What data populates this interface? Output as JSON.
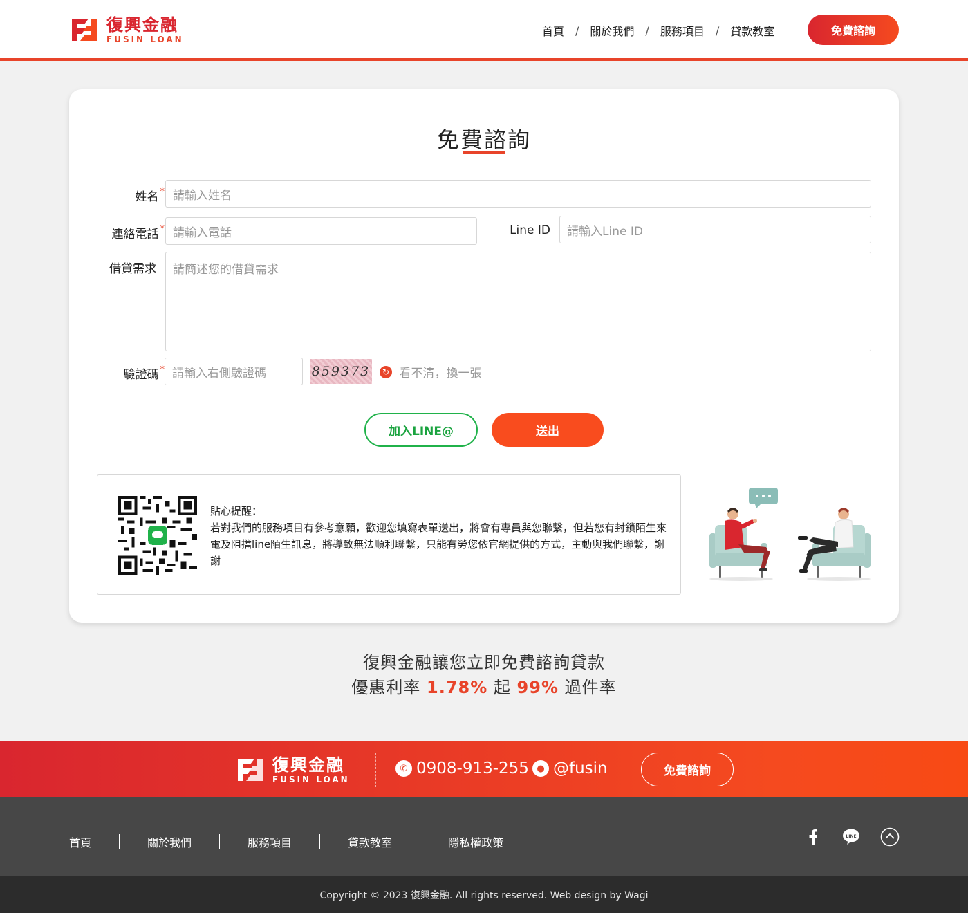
{
  "header": {
    "logo_zh": "復興金融",
    "logo_en": "FUSIN LOAN",
    "nav": [
      "首頁",
      "關於我們",
      "服務項目",
      "貸款教室"
    ],
    "nav_separator": "/",
    "cta": "免費諮詢"
  },
  "form": {
    "title": "免費諮詢",
    "name_label": "姓名",
    "name_placeholder": "請輸入姓名",
    "phone_label": "連絡電話",
    "phone_placeholder": "請輸入電話",
    "lineid_label": "Line ID",
    "lineid_placeholder": "請輸入Line ID",
    "need_label": "借貸需求",
    "need_placeholder": "請簡述您的借貸需求",
    "captcha_label": "驗證碼",
    "captcha_placeholder": "請輸入右側驗證碼",
    "captcha_code": "859373",
    "captcha_refresh": "看不清，換一張",
    "required_mark": "*",
    "line_button": "加入LINE@",
    "submit_button": "送出"
  },
  "notice": {
    "title": "貼心提醒：",
    "body": "若對我們的服務項目有參考意願，歡迎您填寫表單送出，將會有專員與您聯繫，但若您有封鎖陌生來電及阻擋line陌生訊息，將導致無法順利聯繫，只能有勞您依官網提供的方式，主動與我們聯繫，謝謝"
  },
  "tagline": {
    "line1": "復興金融讓您立即免費諮詢貸款",
    "line2_prefix": "優惠利率",
    "rate": "1.78%",
    "line2_mid": "起",
    "pass_rate": "99%",
    "line2_suffix": "過件率"
  },
  "footer": {
    "phone": "0908-913-255",
    "line_id": "@fusin",
    "cta": "免費諮詢",
    "nav": [
      "首頁",
      "關於我們",
      "服務項目",
      "貸款教室",
      "隱私權政策"
    ],
    "copyright": "Copyright © 2023 復興金融. All rights reserved. Web design by Wagi"
  },
  "colors": {
    "brand_red": "#d9262f",
    "brand_orange": "#f54a1f",
    "line_green": "#20b24a"
  },
  "icons": [
    "fusin-logo-icon",
    "refresh-icon",
    "qr-code-icon",
    "phone-icon",
    "line-icon",
    "facebook-icon",
    "line-social-icon",
    "back-to-top-icon"
  ]
}
